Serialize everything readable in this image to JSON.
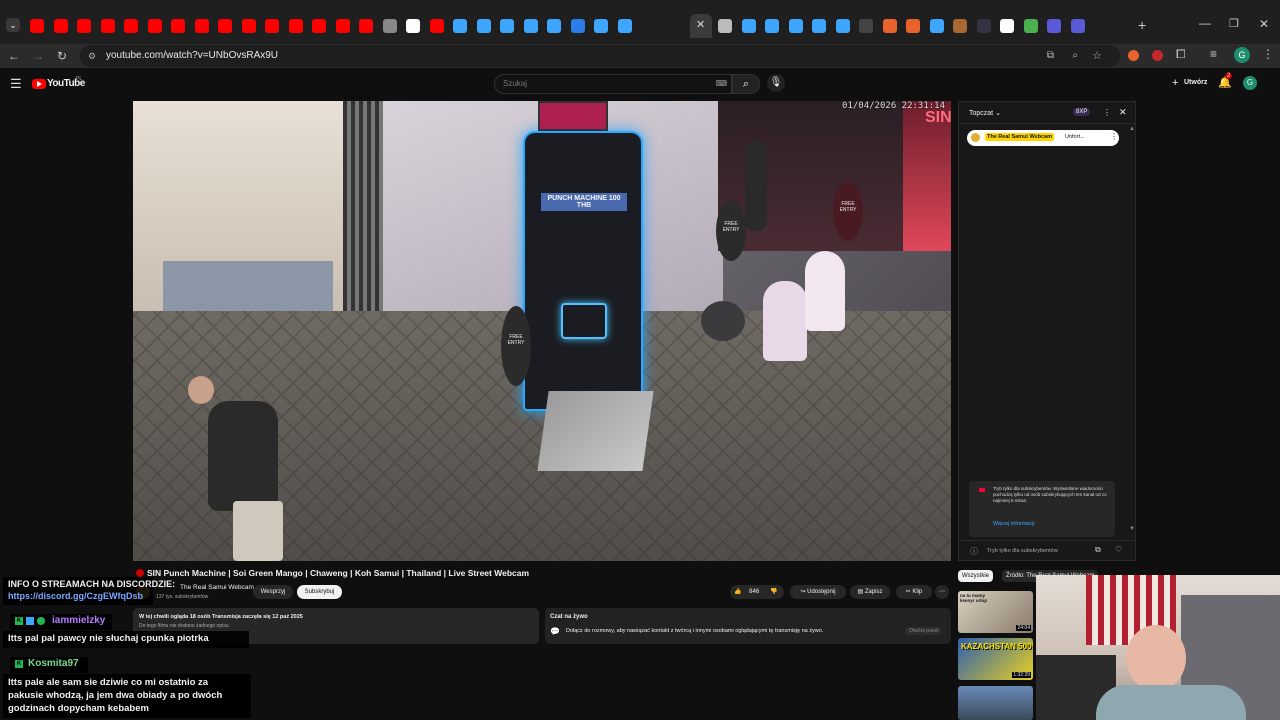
{
  "browser": {
    "url": "youtube.com/watch?v=UNbOvsRAx9U",
    "profile_initial": "G"
  },
  "youtube": {
    "logo_text": "YouTube",
    "logo_badge": "PL",
    "search_placeholder": "Szukaj",
    "create_label": "Utwórz",
    "notif_count": "2",
    "avatar_initial": "G"
  },
  "video": {
    "timestamp": "01/04/2026 22:31:14",
    "title": "SIN Punch Machine | Soi Green Mango | Chaweng | Koh Samui | Thailand | Live Street Webcam",
    "scene_texts": {
      "machine_top": "PUNCH MACHINE 100 THB",
      "free_entry_1": "FREE ENTRY",
      "free_entry_2": "FREE ENTRY",
      "free_entry_3": "FREE ENTRY",
      "sign_text": "SIN"
    }
  },
  "channel": {
    "name": "The Real Samui Webcam",
    "subs": "137 tys. subskrybentów",
    "support_label": "Wesprzyj",
    "subscribe_label": "Subskrybuj"
  },
  "actions": {
    "likes": "846",
    "share": "Udostępnij",
    "save": "Zapisz",
    "clip": "Klip"
  },
  "description": {
    "line1": "W tej chwili ogląda 18 osób  Transmisja zaczęła się 12 paź 2025",
    "line2": "Do tego filmu nie dodano żadnego opisu."
  },
  "chat_info": {
    "title": "Czat na żywo",
    "text": "Dołącz do rozmowy, aby nawiązać kontakt z twórcą i innymi osobami oglądającymi tę transmisję na żywo.",
    "button": "Otwórz panel"
  },
  "chat": {
    "header": "Topczat",
    "points": "8XP",
    "pinned_channel": "The Real Samui Webcam",
    "pinned_text": "Unfort...",
    "sub_notice": "Tryb tylko dla subskrybentów. Wyświetlane wiadomości pochodzą tylko od osób subskrybujących ten kanał od co najmniej 5 minut.",
    "more_info": "Więcej informacji",
    "input_placeholder": "Tryb tylko dla subskrybentów"
  },
  "related": {
    "chip_all": "Wszystkie",
    "chip_source": "Źródło: The Real Samui Webcam",
    "thumb1_title": "na tu mamy ksenyr urlop",
    "thumb1_duration": "24:04",
    "thumb2_title": "KAZACHSTAN 500%",
    "thumb2_duration": "1:32:39"
  },
  "overlay": {
    "info_title": "INFO O STREAMACH NA DISCORDZIE:",
    "info_link": "https://discord.gg/CzgEWfqDsb",
    "msg1_user": "iammielzky",
    "msg1_text": "Itts pal pal pawcy nie słuchaj cpunka piotrka",
    "msg2_user": "Kosmita97",
    "msg2_text": "Itts pale ale sam sie dziwie co mi ostatnio za pakusie whodzą, ja jem dwa obiady a po dwóch godzinach dopycham kebabem",
    "colors": {
      "link": "#7aa7ff",
      "user1": "#b57cff",
      "user2": "#7bd88f",
      "badge_green": "#1db954"
    }
  }
}
